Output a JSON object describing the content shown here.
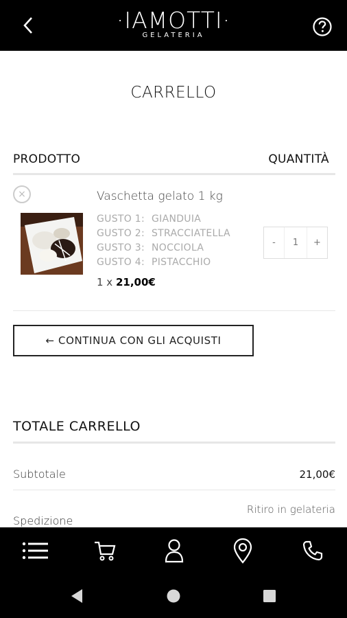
{
  "header": {
    "brand": "·IAMOTTI·",
    "subtitle": "GELATERIA",
    "back_icon": "chevron-left-icon",
    "help_icon": "question-circle-icon"
  },
  "page_title": "CARRELLO",
  "table_headers": {
    "product": "PRODOTTO",
    "quantity": "QUANTITÀ"
  },
  "cart_item": {
    "name": "Vaschetta gelato 1 kg",
    "options": [
      {
        "key": "GUSTO 1:",
        "value": "GIANDUIA"
      },
      {
        "key": "GUSTO 2:",
        "value": "STRACCIATELLA"
      },
      {
        "key": "GUSTO 3:",
        "value": "NOCCIOLA"
      },
      {
        "key": "GUSTO 4:",
        "value": "PISTACCHIO"
      }
    ],
    "price_prefix": "1 x",
    "price": "21,00€",
    "quantity": "1",
    "minus": "-",
    "plus": "+",
    "remove": "×"
  },
  "continue_label": "← CONTINUA CON GLI ACQUISTI",
  "totals": {
    "title": "TOTALE CARRELLO",
    "subtotal_label": "Subtotale",
    "subtotal_value": "21,00€",
    "shipping_label": "Spedizione",
    "shipping_value": "Ritiro in gelateria"
  },
  "bottom_nav": [
    "menu-icon",
    "cart-icon",
    "user-icon",
    "location-pin-icon",
    "phone-icon"
  ],
  "system_nav": [
    "back-triangle-icon",
    "home-circle-icon",
    "recents-square-icon"
  ],
  "colors": {
    "bar": "#000000",
    "rule": "#e6e6e6",
    "muted": "#aaaaaa"
  }
}
